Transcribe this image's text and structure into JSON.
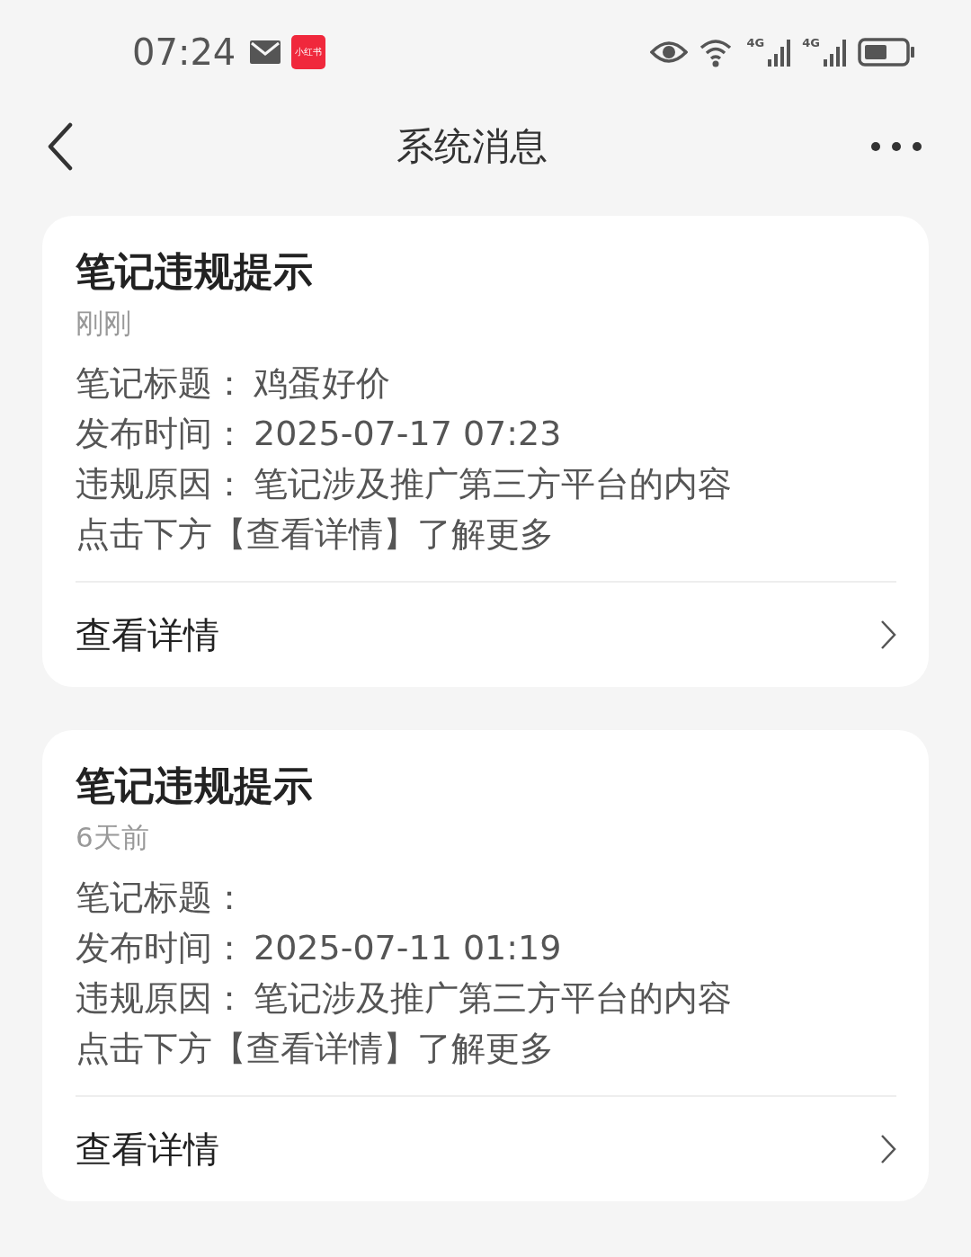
{
  "status_bar": {
    "time": "07:24",
    "app_badge": "小红书",
    "network_1": "4G",
    "network_2": "4G"
  },
  "header": {
    "title": "系统消息"
  },
  "messages": [
    {
      "title": "笔记违规提示",
      "time": "刚刚",
      "fields": [
        {
          "label": "笔记标题：",
          "value": "鸡蛋好价"
        },
        {
          "label": "发布时间：",
          "value": "2025-07-17 07:23"
        },
        {
          "label": "违规原因：",
          "value": "笔记涉及推广第三方平台的内容"
        }
      ],
      "hint": "点击下方【查看详情】了解更多",
      "link": "查看详情"
    },
    {
      "title": "笔记违规提示",
      "time": "6天前",
      "fields": [
        {
          "label": "笔记标题："
        },
        {
          "label": "发布时间：",
          "value": "2025-07-11 01:19"
        },
        {
          "label": "违规原因：",
          "value": "笔记涉及推广第三方平台的内容"
        }
      ],
      "hint": "点击下方【查看详情】了解更多",
      "link": "查看详情"
    }
  ]
}
